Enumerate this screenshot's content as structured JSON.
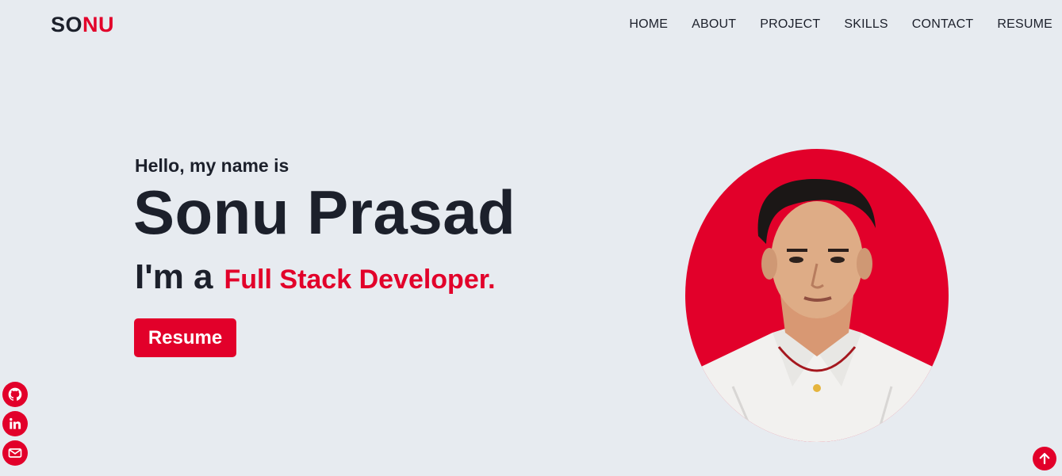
{
  "header": {
    "logo_part1": "SO",
    "logo_part2": "NU",
    "nav": [
      "HOME",
      "ABOUT",
      "PROJECT",
      "SKILLS",
      "CONTACT",
      "RESUME"
    ]
  },
  "hero": {
    "greeting": "Hello, my name is",
    "name": "Sonu Prasad",
    "role_prefix": "I'm a",
    "role_title": "Full Stack Developer.",
    "resume_button": "Resume"
  },
  "portrait": {
    "icon": "profile-photo"
  },
  "social": [
    {
      "icon": "github-icon"
    },
    {
      "icon": "linkedin-icon"
    },
    {
      "icon": "mail-icon"
    }
  ],
  "scroll_top": {
    "icon": "arrow-up-icon"
  },
  "colors": {
    "accent": "#e2002a",
    "background": "#e7ebf0",
    "text": "#1c202b"
  }
}
